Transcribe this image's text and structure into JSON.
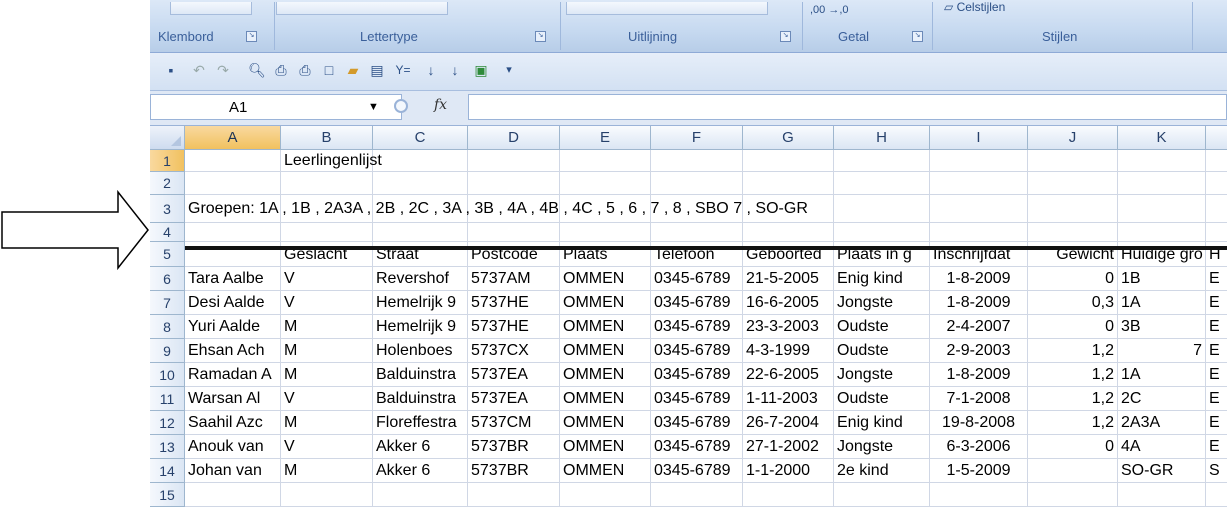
{
  "ribbon": {
    "groups": [
      {
        "label": "Klembord"
      },
      {
        "label": "Lettertype"
      },
      {
        "label": "Uitlijning"
      },
      {
        "label": "Getal"
      },
      {
        "label": "Stijlen"
      }
    ],
    "number_format_glyph": ",00 →,0",
    "cell_styles_label": "Celstijlen"
  },
  "qat": {
    "icons": [
      "save-icon",
      "undo-icon",
      "redo-icon",
      "print-preview-icon",
      "quick-print-icon",
      "print-icon",
      "new-icon",
      "open-icon",
      "page-setup-icon",
      "autofilter-icon",
      "sort-ascending-icon",
      "sort-descending-icon",
      "form-icon",
      "customize-qat-icon"
    ]
  },
  "formula_bar": {
    "name_box": "A1",
    "fx": "fx",
    "formula": ""
  },
  "grid": {
    "columns": [
      "A",
      "B",
      "C",
      "D",
      "E",
      "F",
      "G",
      "H",
      "I",
      "J",
      "K",
      ""
    ],
    "rows": [
      {
        "n": "1",
        "cells": [
          "",
          "Leerlingenlijst",
          "",
          "",
          "",
          "",
          "",
          "",
          "",
          "",
          "",
          ""
        ]
      },
      {
        "n": "2",
        "cells": [
          "",
          "",
          "",
          "",
          "",
          "",
          "",
          "",
          "",
          "",
          "",
          ""
        ]
      },
      {
        "n": "3",
        "cells": [
          "Groepen: 1A , 1B , 2A3A , 2B , 2C , 3A , 3B , 4A , 4B , 4C , 5 , 6 , 7 , 8 , SBO 7 , SO-GR",
          "",
          "",
          "",
          "",
          "",
          "",
          "",
          "",
          "",
          "",
          ""
        ]
      },
      {
        "n": "4",
        "cells": [
          "",
          "",
          "",
          "",
          "",
          "",
          "",
          "",
          "",
          "",
          "",
          ""
        ]
      },
      {
        "n": "5",
        "cells": [
          "",
          "Geslacht",
          "Straat",
          "Postcode",
          "Plaats",
          "Telefoon",
          "Geboorted",
          "Plaats in g",
          "Inschrijfdat",
          "Gewicht",
          "Huidige gro",
          "H"
        ]
      },
      {
        "n": "6",
        "cells": [
          "Tara Aalbe",
          "V",
          "Revershof",
          "5737AM",
          "OMMEN",
          "0345-6789",
          "21-5-2005",
          "Enig kind",
          "1-8-2009",
          "0",
          "1B",
          "E"
        ]
      },
      {
        "n": "7",
        "cells": [
          "Desi Aalde",
          "V",
          "Hemelrijk 9",
          "5737HE",
          "OMMEN",
          "0345-6789",
          "16-6-2005",
          "Jongste",
          "1-8-2009",
          "0,3",
          "1A",
          "E"
        ]
      },
      {
        "n": "8",
        "cells": [
          "Yuri Aalde",
          "M",
          "Hemelrijk 9",
          "5737HE",
          "OMMEN",
          "0345-6789",
          "23-3-2003",
          "Oudste",
          "2-4-2007",
          "0",
          "3B",
          "E"
        ]
      },
      {
        "n": "9",
        "cells": [
          "Ehsan Ach",
          "M",
          "Holenboes",
          "5737CX",
          "OMMEN",
          "0345-6789",
          "4-3-1999",
          "Oudste",
          "2-9-2003",
          "1,2",
          "7",
          "E"
        ]
      },
      {
        "n": "10",
        "cells": [
          "Ramadan A",
          "M",
          "Balduinstra",
          "5737EA",
          "OMMEN",
          "0345-6789",
          "22-6-2005",
          "Jongste",
          "1-8-2009",
          "1,2",
          "1A",
          "E"
        ]
      },
      {
        "n": "11",
        "cells": [
          "Warsan Al",
          "V",
          "Balduinstra",
          "5737EA",
          "OMMEN",
          "0345-6789",
          "1-11-2003",
          "Oudste",
          "7-1-2008",
          "1,2",
          "2C",
          "E"
        ]
      },
      {
        "n": "12",
        "cells": [
          "Saahil Azc",
          "M",
          "Floreffestra",
          "5737CM",
          "OMMEN",
          "0345-6789",
          "26-7-2004",
          "Enig kind",
          "19-8-2008",
          "1,2",
          "2A3A",
          "E"
        ]
      },
      {
        "n": "13",
        "cells": [
          "Anouk van",
          "V",
          "Akker 6",
          "5737BR",
          "OMMEN",
          "0345-6789",
          "27-1-2002",
          "Jongste",
          "6-3-2006",
          "0",
          "4A",
          "E"
        ]
      },
      {
        "n": "14",
        "cells": [
          "Johan van",
          "M",
          "Akker 6",
          "5737BR",
          "OMMEN",
          "0345-6789",
          "1-1-2000",
          "2e kind",
          "1-5-2009",
          "",
          "SO-GR",
          "S"
        ]
      },
      {
        "n": "15",
        "cells": [
          "",
          "",
          "",
          "",
          "",
          "",
          "",
          "",
          "",
          "",
          "",
          ""
        ]
      }
    ]
  }
}
